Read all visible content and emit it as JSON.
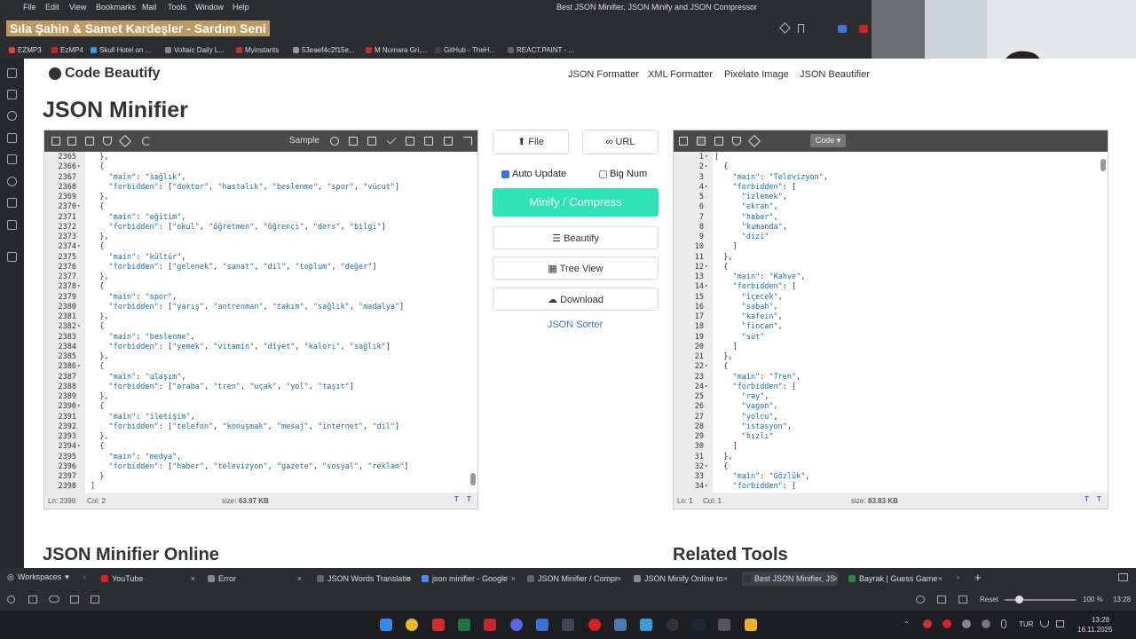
{
  "menu": {
    "items": [
      "File",
      "Edit",
      "View",
      "Bookmarks",
      "Mail",
      "Tools",
      "Window",
      "Help"
    ],
    "window_title": "Best JSON Minifier, JSON Minify and JSON Compressor"
  },
  "toolbar": {
    "song_title": "Sıla Şahin & Samet Kardeşler - Sardım Seni"
  },
  "bookmarks": [
    {
      "label": "EZMP3",
      "color": "#e04040"
    },
    {
      "label": "EzMP4",
      "color": "#d02020"
    },
    {
      "label": "Skull Hotel on ...",
      "color": "#3aa0e0"
    },
    {
      "label": "Voltaic Daily L...",
      "color": "#888"
    },
    {
      "label": "Myinstants",
      "color": "#c03030"
    },
    {
      "label": "53eaef4c2f15e...",
      "color": "#999"
    },
    {
      "label": "M Numara Gri,...",
      "color": "#c03030"
    },
    {
      "label": "GitHub - TheH...",
      "color": "#444"
    },
    {
      "label": "REACT.PAINT - ...",
      "color": "#666"
    }
  ],
  "site": {
    "logo": "Code Beautify",
    "nav": [
      "JSON Formatter",
      "XML Formatter",
      "Pixelate Image",
      "JSON Beautifier"
    ],
    "title": "JSON Minifier",
    "section_left": "JSON Minifier Online",
    "section_right": "Related Tools"
  },
  "left_editor": {
    "sample_label": "Sample",
    "footer_ln": "Ln: 2398",
    "footer_col": "Col: 2",
    "footer_size_label": "size:",
    "footer_size": "63.97 KB",
    "lines": [
      {
        "n": "2365",
        "t": "  },"
      },
      {
        "n": "2366",
        "t": "  {",
        "f": 1
      },
      {
        "n": "2367",
        "t": "    \"main\": \"sağlık\","
      },
      {
        "n": "2368",
        "t": "    \"forbidden\": [\"doktor\", \"hastalık\", \"beslenme\", \"spor\", \"vücut\"]"
      },
      {
        "n": "2369",
        "t": "  },"
      },
      {
        "n": "2370",
        "t": "  {",
        "f": 1
      },
      {
        "n": "2371",
        "t": "    \"main\": \"eğitim\","
      },
      {
        "n": "2372",
        "t": "    \"forbidden\": [\"okul\", \"öğretmen\", \"öğrenci\", \"ders\", \"bilgi\"]"
      },
      {
        "n": "2373",
        "t": "  },"
      },
      {
        "n": "2374",
        "t": "  {",
        "f": 1
      },
      {
        "n": "2375",
        "t": "    \"main\": \"kültür\","
      },
      {
        "n": "2376",
        "t": "    \"forbidden\": [\"gelenek\", \"sanat\", \"dil\", \"toplum\", \"değer\"]"
      },
      {
        "n": "2377",
        "t": "  },"
      },
      {
        "n": "2378",
        "t": "  {",
        "f": 1
      },
      {
        "n": "2379",
        "t": "    \"main\": \"spor\","
      },
      {
        "n": "2380",
        "t": "    \"forbidden\": [\"yarış\", \"antrenman\", \"takım\", \"sağlık\", \"madalya\"]"
      },
      {
        "n": "2381",
        "t": "  },"
      },
      {
        "n": "2382",
        "t": "  {",
        "f": 1
      },
      {
        "n": "2383",
        "t": "    \"main\": \"beslenme\","
      },
      {
        "n": "2384",
        "t": "    \"forbidden\": [\"yemek\", \"vitamin\", \"diyet\", \"kalori\", \"sağlık\"]"
      },
      {
        "n": "2385",
        "t": "  },"
      },
      {
        "n": "2386",
        "t": "  {",
        "f": 1
      },
      {
        "n": "2387",
        "t": "    \"main\": \"ulaşım\","
      },
      {
        "n": "2388",
        "t": "    \"forbidden\": [\"araba\", \"tren\", \"uçak\", \"yol\", \"taşıt\"]"
      },
      {
        "n": "2389",
        "t": "  },"
      },
      {
        "n": "2390",
        "t": "  {",
        "f": 1
      },
      {
        "n": "2391",
        "t": "    \"main\": \"iletişim\","
      },
      {
        "n": "2392",
        "t": "    \"forbidden\": [\"telefon\", \"konuşmak\", \"mesaj\", \"internet\", \"dil\"]"
      },
      {
        "n": "2393",
        "t": "  },"
      },
      {
        "n": "2394",
        "t": "  {",
        "f": 1
      },
      {
        "n": "2395",
        "t": "    \"main\": \"medya\","
      },
      {
        "n": "2396",
        "t": "    \"forbidden\": [\"haber\", \"televizyon\", \"gazete\", \"sosyal\", \"reklam\"]"
      },
      {
        "n": "2397",
        "t": "  }"
      },
      {
        "n": "2398",
        "t": "]"
      }
    ]
  },
  "middle": {
    "file": "File",
    "url": "URL",
    "auto_update": "Auto Update",
    "big_num": "Big Num",
    "minify": "Minify / Compress",
    "beautify": "Beautify",
    "tree_view": "Tree View",
    "download": "Download",
    "sorter": "JSON Sorter"
  },
  "right_editor": {
    "mode": "Code",
    "footer_ln": "Ln: 1",
    "footer_col": "Col: 1",
    "footer_size_label": "size:",
    "footer_size": "83.83 KB",
    "lines": [
      {
        "n": "1",
        "t": "[",
        "f": 1
      },
      {
        "n": "2",
        "t": "  {",
        "f": 1
      },
      {
        "n": "3",
        "t": "    \"main\": \"Televizyon\","
      },
      {
        "n": "4",
        "t": "    \"forbidden\": [",
        "f": 1
      },
      {
        "n": "5",
        "t": "      \"izlemek\","
      },
      {
        "n": "6",
        "t": "      \"ekran\","
      },
      {
        "n": "7",
        "t": "      \"haber\","
      },
      {
        "n": "8",
        "t": "      \"kumanda\","
      },
      {
        "n": "9",
        "t": "      \"dizi\""
      },
      {
        "n": "10",
        "t": "    ]"
      },
      {
        "n": "11",
        "t": "  },"
      },
      {
        "n": "12",
        "t": "  {",
        "f": 1
      },
      {
        "n": "13",
        "t": "    \"main\": \"Kahve\","
      },
      {
        "n": "14",
        "t": "    \"forbidden\": [",
        "f": 1
      },
      {
        "n": "15",
        "t": "      \"içecek\","
      },
      {
        "n": "16",
        "t": "      \"sabah\","
      },
      {
        "n": "17",
        "t": "      \"kafein\","
      },
      {
        "n": "18",
        "t": "      \"fincan\","
      },
      {
        "n": "19",
        "t": "      \"süt\""
      },
      {
        "n": "20",
        "t": "    ]"
      },
      {
        "n": "21",
        "t": "  },"
      },
      {
        "n": "22",
        "t": "  {",
        "f": 1
      },
      {
        "n": "23",
        "t": "    \"main\": \"Tren\","
      },
      {
        "n": "24",
        "t": "    \"forbidden\": [",
        "f": 1
      },
      {
        "n": "25",
        "t": "      \"ray\","
      },
      {
        "n": "26",
        "t": "      \"vagon\","
      },
      {
        "n": "27",
        "t": "      \"yolcu\","
      },
      {
        "n": "28",
        "t": "      \"istasyon\","
      },
      {
        "n": "29",
        "t": "      \"hızlı\""
      },
      {
        "n": "30",
        "t": "    ]"
      },
      {
        "n": "31",
        "t": "  },"
      },
      {
        "n": "32",
        "t": "  {",
        "f": 1
      },
      {
        "n": "33",
        "t": "    \"main\": \"Gözlük\","
      },
      {
        "n": "34",
        "t": "    \"forbidden\": [",
        "f": 1
      }
    ]
  },
  "tabs": {
    "workspaces": "Workspaces",
    "items": [
      {
        "label": "YouTube",
        "color": "#e02020"
      },
      {
        "label": "Error",
        "color": "#888"
      },
      {
        "label": "JSON Words Translatio",
        "color": "#666"
      },
      {
        "label": "json minifier - Google",
        "color": "#4a8af4"
      },
      {
        "label": "JSON Minifier / Compr",
        "color": "#666"
      },
      {
        "label": "JSON Minify Online to",
        "color": "#888"
      },
      {
        "label": "Best JSON Minifier, JS",
        "color": "#333"
      },
      {
        "label": "Bayrak | Guess Game",
        "color": "#2a8a4a"
      }
    ]
  },
  "status": {
    "reset": "Reset",
    "zoom": "100 %",
    "time": "13:28"
  },
  "taskbar": {
    "lang": "TUR",
    "time": "13:28",
    "date": "16.11.2025"
  }
}
